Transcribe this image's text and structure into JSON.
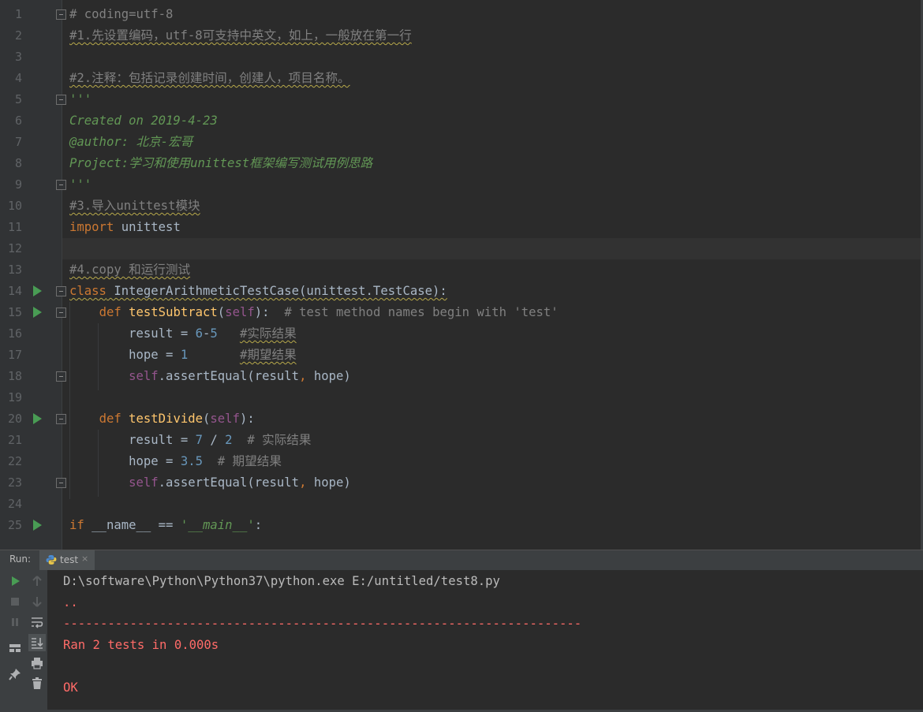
{
  "editor": {
    "lines": [
      {
        "n": "1",
        "tokens": [
          {
            "t": "# coding=utf-8",
            "c": "cmt"
          }
        ]
      },
      {
        "n": "2",
        "tokens": [
          {
            "t": "#1.先设置编码，utf-8可支持中英文，如上，一般放在第一行",
            "c": "cmt sq"
          }
        ]
      },
      {
        "n": "3",
        "tokens": []
      },
      {
        "n": "4",
        "tokens": [
          {
            "t": "#2.注释：包括记录创建时间，创建人，项目名称。",
            "c": "cmt sq"
          }
        ]
      },
      {
        "n": "5",
        "tokens": [
          {
            "t": "'''",
            "c": "doc"
          }
        ]
      },
      {
        "n": "6",
        "tokens": [
          {
            "t": "Created on 2019-4-23",
            "c": "doc"
          }
        ]
      },
      {
        "n": "7",
        "tokens": [
          {
            "t": "@author: 北京-宏哥",
            "c": "doc"
          }
        ]
      },
      {
        "n": "8",
        "tokens": [
          {
            "t": "Project:学习和使用unittest框架编写测试用例思路",
            "c": "doc"
          }
        ]
      },
      {
        "n": "9",
        "tokens": [
          {
            "t": "'''",
            "c": "doc"
          }
        ]
      },
      {
        "n": "10",
        "tokens": [
          {
            "t": "#3.导入unittest模块",
            "c": "cmt sq"
          }
        ]
      },
      {
        "n": "11",
        "tokens": [
          {
            "t": "import",
            "c": "kw"
          },
          {
            "t": " unittest",
            "c": ""
          }
        ]
      },
      {
        "n": "12",
        "tokens": []
      },
      {
        "n": "13",
        "tokens": [
          {
            "t": "#4.copy 和运行测试",
            "c": "cmt sq"
          }
        ]
      },
      {
        "n": "14",
        "tokens": [
          {
            "t": "class",
            "c": "kw sq"
          },
          {
            "t": " IntegerArithmeticTestCase(unittest.TestCase):",
            "c": "sq"
          }
        ]
      },
      {
        "n": "15",
        "tokens": [
          {
            "t": "    ",
            "c": ""
          },
          {
            "t": "def",
            "c": "kw"
          },
          {
            "t": " ",
            "c": ""
          },
          {
            "t": "testSubtract",
            "c": "fn"
          },
          {
            "t": "(",
            "c": ""
          },
          {
            "t": "self",
            "c": "slf"
          },
          {
            "t": "):  ",
            "c": ""
          },
          {
            "t": "# test method names begin with 'test'",
            "c": "cmt"
          }
        ]
      },
      {
        "n": "16",
        "tokens": [
          {
            "t": "        result = ",
            "c": ""
          },
          {
            "t": "6",
            "c": "num"
          },
          {
            "t": "-",
            "c": ""
          },
          {
            "t": "5",
            "c": "num"
          },
          {
            "t": "   ",
            "c": ""
          },
          {
            "t": "#实际结果",
            "c": "cmt sq"
          }
        ]
      },
      {
        "n": "17",
        "tokens": [
          {
            "t": "        hope = ",
            "c": ""
          },
          {
            "t": "1",
            "c": "num"
          },
          {
            "t": "       ",
            "c": ""
          },
          {
            "t": "#期望结果",
            "c": "cmt sq"
          }
        ]
      },
      {
        "n": "18",
        "tokens": [
          {
            "t": "        ",
            "c": ""
          },
          {
            "t": "self",
            "c": "slf"
          },
          {
            "t": ".assertEqual(result",
            "c": ""
          },
          {
            "t": ",",
            "c": "kw"
          },
          {
            "t": " hope)",
            "c": ""
          }
        ]
      },
      {
        "n": "19",
        "tokens": []
      },
      {
        "n": "20",
        "tokens": [
          {
            "t": "    ",
            "c": ""
          },
          {
            "t": "def",
            "c": "kw"
          },
          {
            "t": " ",
            "c": ""
          },
          {
            "t": "testDivide",
            "c": "fn"
          },
          {
            "t": "(",
            "c": ""
          },
          {
            "t": "self",
            "c": "slf"
          },
          {
            "t": "):",
            "c": ""
          }
        ]
      },
      {
        "n": "21",
        "tokens": [
          {
            "t": "        result = ",
            "c": ""
          },
          {
            "t": "7",
            "c": "num"
          },
          {
            "t": " / ",
            "c": ""
          },
          {
            "t": "2",
            "c": "num"
          },
          {
            "t": "  ",
            "c": ""
          },
          {
            "t": "# 实际结果",
            "c": "cmt"
          }
        ]
      },
      {
        "n": "22",
        "tokens": [
          {
            "t": "        hope = ",
            "c": ""
          },
          {
            "t": "3.5",
            "c": "num"
          },
          {
            "t": "  ",
            "c": ""
          },
          {
            "t": "# 期望结果",
            "c": "cmt"
          }
        ]
      },
      {
        "n": "23",
        "tokens": [
          {
            "t": "        ",
            "c": ""
          },
          {
            "t": "self",
            "c": "slf"
          },
          {
            "t": ".assertEqual(result",
            "c": ""
          },
          {
            "t": ",",
            "c": "kw"
          },
          {
            "t": " hope)",
            "c": ""
          }
        ]
      },
      {
        "n": "24",
        "tokens": []
      },
      {
        "n": "25",
        "tokens": [
          {
            "t": "if",
            "c": "kw"
          },
          {
            "t": " __name__ == ",
            "c": ""
          },
          {
            "t": "'__main__'",
            "c": "doc"
          },
          {
            "t": ":",
            "c": ""
          }
        ]
      }
    ],
    "run_gutter_lines": [
      "14",
      "15",
      "20",
      "25"
    ],
    "fold_lines": [
      "1",
      "5",
      "9",
      "14",
      "15",
      "18",
      "20",
      "23"
    ],
    "current_line": "12"
  },
  "run_panel": {
    "label": "Run:",
    "tab_label": "test",
    "tab_close": "×",
    "console": [
      {
        "text": "D:\\software\\Python\\Python37\\python.exe E:/untitled/test8.py",
        "color": "#bbbbbb"
      },
      {
        "text": "..",
        "color": "#ff6b68"
      },
      {
        "text": "----------------------------------------------------------------------",
        "color": "#ff6b68"
      },
      {
        "text": "Ran 2 tests in 0.000s",
        "color": "#ff6b68"
      },
      {
        "text": "",
        "color": "#ff6b68"
      },
      {
        "text": "OK",
        "color": "#ff6b68"
      }
    ]
  },
  "colors": {
    "keyword": "#cc7832",
    "function": "#ffc66d",
    "number": "#6897bb",
    "self": "#94558d",
    "comment": "#808080",
    "docstring": "#629755",
    "run_green": "#499c54",
    "stderr_red": "#ff6b68"
  },
  "icons": {
    "toolbar": [
      "rerun-icon",
      "stop-icon",
      "pause-icon",
      "layout-icon",
      "pin-icon",
      "up-arrow-icon",
      "down-arrow-icon",
      "soft-wrap-icon",
      "scroll-to-end-icon",
      "print-icon",
      "trash-icon"
    ]
  }
}
